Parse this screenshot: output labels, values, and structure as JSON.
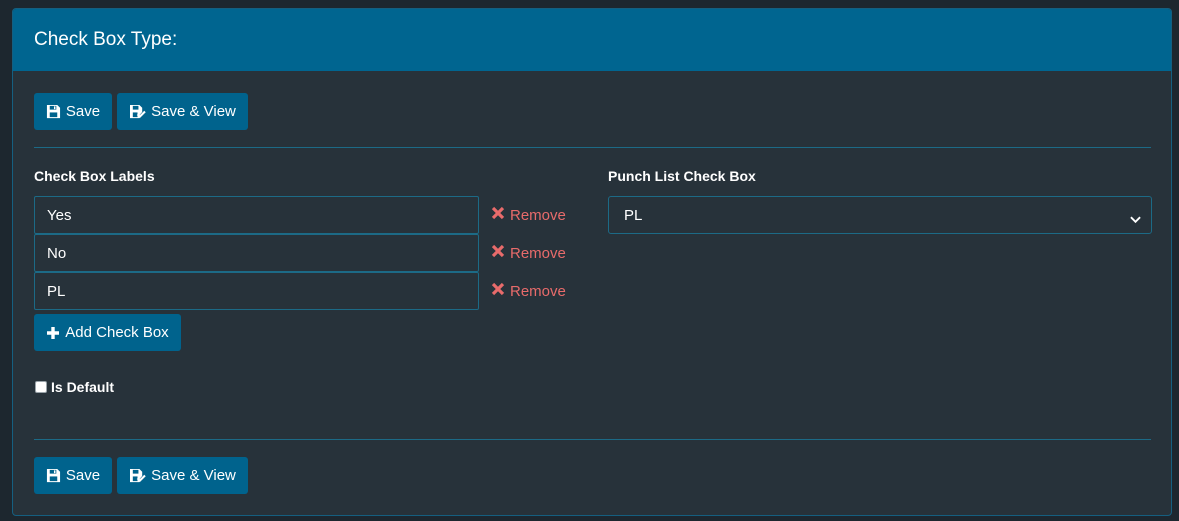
{
  "header": {
    "title": "Check Box Type:"
  },
  "toolbar": {
    "save_label": "Save",
    "save_view_label": "Save & View"
  },
  "labels_section": {
    "heading": "Check Box Labels",
    "items": [
      {
        "value": "Yes",
        "remove_label": "Remove"
      },
      {
        "value": "No",
        "remove_label": "Remove"
      },
      {
        "value": "PL",
        "remove_label": "Remove"
      }
    ],
    "add_label": "Add Check Box"
  },
  "punch_list": {
    "heading": "Punch List Check Box",
    "selected": "PL"
  },
  "default_option": {
    "label": "Is Default",
    "checked": false
  },
  "icons": {
    "save": "floppy-disk-icon",
    "save_view": "floppy-check-icon",
    "remove": "x-icon",
    "add": "plus-icon",
    "dropdown": "chevron-down-icon"
  },
  "colors": {
    "header_bg": "#006590",
    "panel_bg": "#27323a",
    "button_bg": "#00638d",
    "border": "#1c6a86",
    "remove": "#e86b6b"
  }
}
